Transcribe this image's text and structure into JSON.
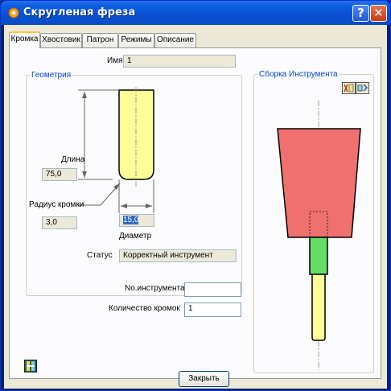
{
  "window": {
    "title": "Скругленая фреза",
    "help_glyph": "?",
    "close_glyph": "✕"
  },
  "tabs": [
    {
      "label": "Кромка",
      "active": true
    },
    {
      "label": "Хвостовик",
      "active": false
    },
    {
      "label": "Патрон",
      "active": false
    },
    {
      "label": "Режимы",
      "active": false
    },
    {
      "label": "Описание",
      "active": false
    }
  ],
  "form": {
    "name_label": "Имя",
    "name_value": "1",
    "geometry_legend": "Геометрия",
    "length_label": "Длина",
    "length_value": "75,0",
    "radius_label": "Радиус кромки",
    "radius_value": "3,0",
    "diameter_value": "15,0",
    "diameter_label": "Диаметр",
    "status_label": "Статус",
    "status_value": "Корректный инструмент",
    "tool_number_label": "No.инструмента",
    "tool_number_value": "",
    "flutes_label": "Количество кромок",
    "flutes_value": "1"
  },
  "assembly": {
    "legend": "Сборка Инструмента"
  },
  "footer": {
    "close_label": "Закрыть"
  },
  "colors": {
    "cutter": "#ffff99",
    "holder": "#f07070",
    "shank": "#66dd66",
    "titlebar": "#0a5fe0"
  }
}
